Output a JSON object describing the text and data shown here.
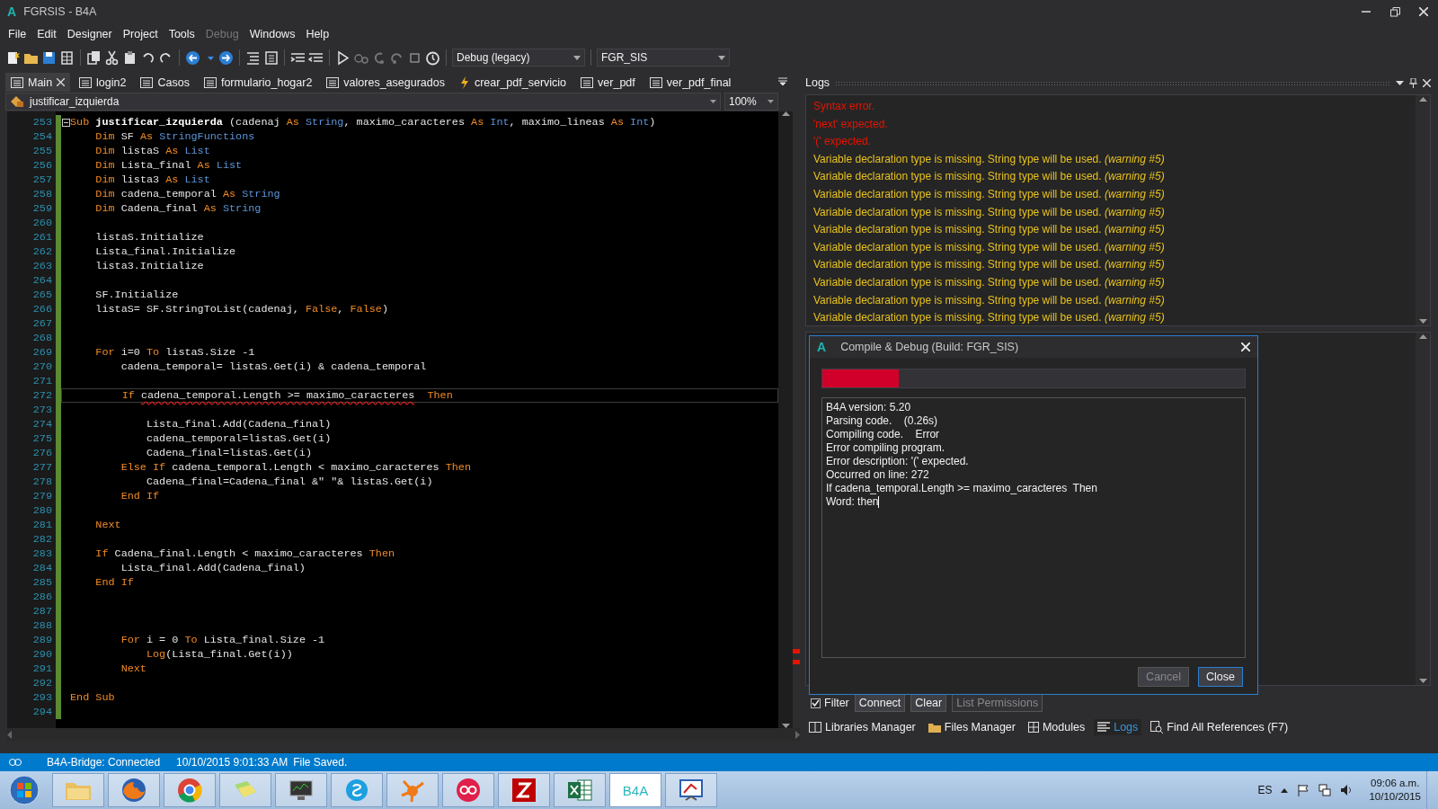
{
  "window": {
    "logo": "A",
    "title": "FGRSIS - B4A"
  },
  "menu": [
    {
      "label": "File",
      "disabled": false
    },
    {
      "label": "Edit",
      "disabled": false
    },
    {
      "label": "Designer",
      "disabled": false
    },
    {
      "label": "Project",
      "disabled": false
    },
    {
      "label": "Tools",
      "disabled": false
    },
    {
      "label": "Debug",
      "disabled": true
    },
    {
      "label": "Windows",
      "disabled": false
    },
    {
      "label": "Help",
      "disabled": false
    }
  ],
  "toolbar": {
    "build_mode": "Debug (legacy)",
    "build_config": "FGR_SIS"
  },
  "tabs": [
    {
      "label": "Main",
      "kind": "module",
      "selected": true
    },
    {
      "label": "login2",
      "kind": "module",
      "selected": false
    },
    {
      "label": "Casos",
      "kind": "module",
      "selected": false
    },
    {
      "label": "formulario_hogar2",
      "kind": "module",
      "selected": false
    },
    {
      "label": "valores_asegurados",
      "kind": "module",
      "selected": false
    },
    {
      "label": "crear_pdf_servicio",
      "kind": "service",
      "selected": false
    },
    {
      "label": "ver_pdf",
      "kind": "module",
      "selected": false
    },
    {
      "label": "ver_pdf_final",
      "kind": "module",
      "selected": false
    }
  ],
  "sub_selector": {
    "value": "justificar_izquierda"
  },
  "zoom": {
    "value": "100%"
  },
  "editor": {
    "lines": [
      {
        "number": "253",
        "expanded": true,
        "current": false,
        "tokens": [
          {
            "text": "Sub ",
            "kind": "keyword"
          },
          {
            "text": "justificar_izquierda",
            "kind": "name"
          },
          {
            "text": " (cadenaj ",
            "kind": "plain"
          },
          {
            "text": "As ",
            "kind": "keyword"
          },
          {
            "text": "String",
            "kind": "type"
          },
          {
            "text": ", maximo_caracteres ",
            "kind": "plain"
          },
          {
            "text": "As ",
            "kind": "keyword"
          },
          {
            "text": "Int",
            "kind": "type"
          },
          {
            "text": ", maximo_lineas ",
            "kind": "plain"
          },
          {
            "text": "As ",
            "kind": "keyword"
          },
          {
            "text": "Int",
            "kind": "type"
          },
          {
            "text": ")",
            "kind": "plain"
          }
        ]
      },
      {
        "number": "254",
        "current": false,
        "tokens": [
          {
            "text": "    Dim",
            "kind": "keyword"
          },
          {
            "text": " SF ",
            "kind": "plain"
          },
          {
            "text": "As ",
            "kind": "keyword"
          },
          {
            "text": "StringFunctions",
            "kind": "type"
          }
        ]
      },
      {
        "number": "255",
        "current": false,
        "tokens": [
          {
            "text": "    Dim",
            "kind": "keyword"
          },
          {
            "text": " listaS ",
            "kind": "plain"
          },
          {
            "text": "As ",
            "kind": "keyword"
          },
          {
            "text": "List",
            "kind": "type"
          }
        ]
      },
      {
        "number": "256",
        "current": false,
        "tokens": [
          {
            "text": "    Dim",
            "kind": "keyword"
          },
          {
            "text": " Lista_final ",
            "kind": "plain"
          },
          {
            "text": "As ",
            "kind": "keyword"
          },
          {
            "text": "List",
            "kind": "type"
          }
        ]
      },
      {
        "number": "257",
        "current": false,
        "tokens": [
          {
            "text": "    Dim",
            "kind": "keyword"
          },
          {
            "text": " lista3 ",
            "kind": "plain"
          },
          {
            "text": "As ",
            "kind": "keyword"
          },
          {
            "text": "List",
            "kind": "type"
          }
        ]
      },
      {
        "number": "258",
        "current": false,
        "tokens": [
          {
            "text": "    Dim",
            "kind": "keyword"
          },
          {
            "text": " cadena_temporal ",
            "kind": "plain"
          },
          {
            "text": "As ",
            "kind": "keyword"
          },
          {
            "text": "String",
            "kind": "type"
          }
        ]
      },
      {
        "number": "259",
        "current": false,
        "tokens": [
          {
            "text": "    Dim",
            "kind": "keyword"
          },
          {
            "text": " Cadena_final ",
            "kind": "plain"
          },
          {
            "text": "As ",
            "kind": "keyword"
          },
          {
            "text": "String",
            "kind": "type"
          }
        ]
      },
      {
        "number": "260",
        "current": false
      },
      {
        "number": "261",
        "current": false,
        "tokens": [
          {
            "text": "    listaS.Initialize",
            "kind": "plain"
          }
        ]
      },
      {
        "number": "262",
        "current": false,
        "tokens": [
          {
            "text": "    Lista_final.Initialize",
            "kind": "plain"
          }
        ]
      },
      {
        "number": "263",
        "current": false,
        "tokens": [
          {
            "text": "    lista3.Initialize",
            "kind": "plain"
          }
        ]
      },
      {
        "number": "264",
        "current": false
      },
      {
        "number": "265",
        "current": false,
        "tokens": [
          {
            "text": "    SF.Initialize",
            "kind": "plain"
          }
        ]
      },
      {
        "number": "266",
        "current": false,
        "tokens": [
          {
            "text": "    listaS= SF.StringToList(cadenaj, ",
            "kind": "plain"
          },
          {
            "text": "False",
            "kind": "keyword"
          },
          {
            "text": ", ",
            "kind": "plain"
          },
          {
            "text": "False",
            "kind": "keyword"
          },
          {
            "text": ")",
            "kind": "plain"
          }
        ]
      },
      {
        "number": "267",
        "current": false
      },
      {
        "number": "268",
        "current": false
      },
      {
        "number": "269",
        "current": false,
        "tokens": [
          {
            "text": "    For",
            "kind": "keyword"
          },
          {
            "text": " i=0 ",
            "kind": "plain"
          },
          {
            "text": "To",
            "kind": "keyword"
          },
          {
            "text": " listaS.Size -1",
            "kind": "plain"
          }
        ]
      },
      {
        "number": "270",
        "current": false,
        "tokens": [
          {
            "text": "        cadena_temporal= listaS.Get(i) & cadena_temporal",
            "kind": "plain"
          }
        ]
      },
      {
        "number": "271",
        "current": false
      },
      {
        "number": "272",
        "current": true,
        "tokens": [
          {
            "text": "        If ",
            "kind": "keyword"
          },
          {
            "text": "cadena_temporal.Length >= maximo_caracteres",
            "kind": "error"
          },
          {
            "text": "  Then",
            "kind": "keyword"
          }
        ]
      },
      {
        "number": "273",
        "current": false
      },
      {
        "number": "274",
        "current": false,
        "tokens": [
          {
            "text": "            Lista_final.Add(Cadena_final)",
            "kind": "plain"
          }
        ]
      },
      {
        "number": "275",
        "current": false,
        "tokens": [
          {
            "text": "            cadena_temporal=listaS.Get(i)",
            "kind": "plain"
          }
        ]
      },
      {
        "number": "276",
        "current": false,
        "tokens": [
          {
            "text": "            Cadena_final=listaS.Get(i)",
            "kind": "plain"
          }
        ]
      },
      {
        "number": "277",
        "current": false,
        "tokens": [
          {
            "text": "        Else If",
            "kind": "keyword"
          },
          {
            "text": " cadena_temporal.Length < maximo_caracteres ",
            "kind": "plain"
          },
          {
            "text": "Then",
            "kind": "keyword"
          }
        ]
      },
      {
        "number": "278",
        "current": false,
        "tokens": [
          {
            "text": "            Cadena_final=Cadena_final &\" \"& listaS.Get(i)",
            "kind": "plain"
          }
        ]
      },
      {
        "number": "279",
        "current": false,
        "tokens": [
          {
            "text": "        End If",
            "kind": "keyword"
          }
        ]
      },
      {
        "number": "280",
        "current": false
      },
      {
        "number": "281",
        "current": false,
        "tokens": [
          {
            "text": "    Next",
            "kind": "keyword"
          }
        ]
      },
      {
        "number": "282",
        "current": false
      },
      {
        "number": "283",
        "current": false,
        "tokens": [
          {
            "text": "    If",
            "kind": "keyword"
          },
          {
            "text": " Cadena_final.Length < maximo_caracteres ",
            "kind": "plain"
          },
          {
            "text": "Then",
            "kind": "keyword"
          }
        ]
      },
      {
        "number": "284",
        "current": false,
        "tokens": [
          {
            "text": "        Lista_final.Add(Cadena_final)",
            "kind": "plain"
          }
        ]
      },
      {
        "number": "285",
        "current": false,
        "tokens": [
          {
            "text": "    End If",
            "kind": "keyword"
          }
        ]
      },
      {
        "number": "286",
        "current": false
      },
      {
        "number": "287",
        "current": false
      },
      {
        "number": "288",
        "current": false
      },
      {
        "number": "289",
        "current": false,
        "tokens": [
          {
            "text": "        For",
            "kind": "keyword"
          },
          {
            "text": " i = 0 ",
            "kind": "plain"
          },
          {
            "text": "To",
            "kind": "keyword"
          },
          {
            "text": " Lista_final.Size -1",
            "kind": "plain"
          }
        ]
      },
      {
        "number": "290",
        "current": false,
        "tokens": [
          {
            "text": "            Log",
            "kind": "keyword"
          },
          {
            "text": "(Lista_final.Get(i))",
            "kind": "plain"
          }
        ]
      },
      {
        "number": "291",
        "current": false,
        "tokens": [
          {
            "text": "        Next",
            "kind": "keyword"
          }
        ]
      },
      {
        "number": "292",
        "current": false
      },
      {
        "number": "293",
        "current": false,
        "tokens": [
          {
            "text": "End Sub",
            "kind": "keyword"
          }
        ]
      },
      {
        "number": "294",
        "current": false
      }
    ]
  },
  "logs": {
    "title": "Logs",
    "entries": [
      {
        "kind": "error",
        "text": "Syntax error."
      },
      {
        "kind": "error",
        "text": "'next' expected."
      },
      {
        "kind": "error",
        "text": "'(' expected."
      },
      {
        "kind": "warning",
        "text": "Variable declaration type is missing. String type will be used. *(warning #5)*"
      },
      {
        "kind": "warning",
        "text": "Variable declaration type is missing. String type will be used. *(warning #5)*"
      },
      {
        "kind": "warning",
        "text": "Variable declaration type is missing. String type will be used. *(warning #5)*"
      },
      {
        "kind": "warning",
        "text": "Variable declaration type is missing. String type will be used. *(warning #5)*"
      },
      {
        "kind": "warning",
        "text": "Variable declaration type is missing. String type will be used. *(warning #5)*"
      },
      {
        "kind": "warning",
        "text": "Variable declaration type is missing. String type will be used. *(warning #5)*"
      },
      {
        "kind": "warning",
        "text": "Variable declaration type is missing. String type will be used. *(warning #5)*"
      },
      {
        "kind": "warning",
        "text": "Variable declaration type is missing. String type will be used. *(warning #5)*"
      },
      {
        "kind": "warning",
        "text": "Variable declaration type is missing. String type will be used. *(warning #5)*"
      },
      {
        "kind": "warning",
        "text": "Variable declaration type is missing. String type will be used. *(warning #5)*"
      }
    ]
  },
  "dialog": {
    "logo": "A",
    "title": "Compile & Debug (Build: FGR_SIS)",
    "level": 0.18,
    "output": [
      "B4A version: 5.20",
      "Parsing code.    (0.26s)",
      "Compiling code.    Error",
      "Error compiling program.",
      "Error description: '(' expected.",
      "Occurred on line: 272",
      "If cadena_temporal.Length >= maximo_caracteres  Then",
      "Word: then"
    ],
    "buttons": [
      {
        "label": "Cancel",
        "disabled": true
      },
      {
        "label": "Close",
        "disabled": false
      }
    ]
  },
  "filter": {
    "label": "Filter",
    "checked": true
  },
  "log_buttons": [
    {
      "label": "Connect",
      "disabled": false
    },
    {
      "label": "Clear",
      "disabled": false
    },
    {
      "label": "List Permissions",
      "disabled": true
    }
  ],
  "bottom_tabs": [
    {
      "label": "Libraries Manager",
      "kind": "libraries",
      "selected": false
    },
    {
      "label": "Files Manager",
      "kind": "files",
      "selected": false
    },
    {
      "label": "Modules",
      "kind": "modules",
      "selected": false
    },
    {
      "label": "Logs",
      "kind": "logs",
      "selected": true
    },
    {
      "label": "Find All References (F7)",
      "kind": "references",
      "selected": false
    }
  ],
  "status_bar": {
    "bridge": "B4A-Bridge: Connected",
    "timestamp": "10/10/2015 9:01:33 AM",
    "message": "File Saved."
  },
  "taskbar": {
    "app_label": "B4A",
    "language": "ES",
    "time": "09:06 a.m.",
    "date": "10/10/2015"
  }
}
